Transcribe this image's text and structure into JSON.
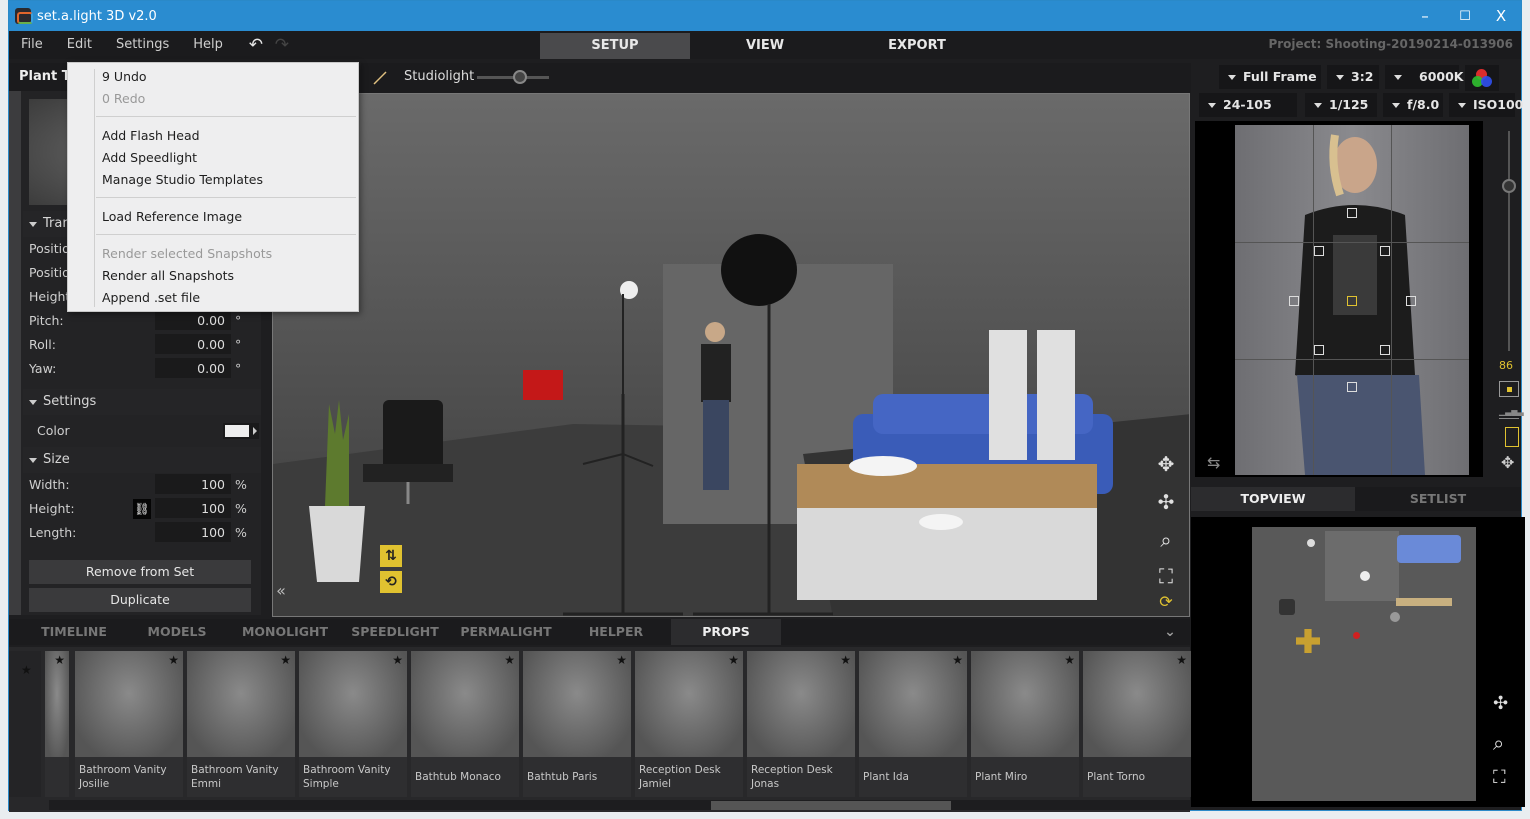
{
  "window": {
    "title": "set.a.light 3D v2.0",
    "controls": {
      "minimize": "–",
      "maximize": "☐",
      "close": "X"
    }
  },
  "menu": {
    "items": [
      "File",
      "Edit",
      "Settings",
      "Help"
    ],
    "undo_icon": "undo-icon",
    "redo_icon": "redo-icon"
  },
  "modes": {
    "tabs": [
      "SETUP",
      "VIEW",
      "EXPORT"
    ],
    "active": "SETUP"
  },
  "project": "Project: Shooting-20190214-013906",
  "edit_menu": {
    "groups": [
      [
        {
          "label": "9 Undo",
          "enabled": true
        },
        {
          "label": "0 Redo",
          "enabled": false
        }
      ],
      [
        {
          "label": "Add Flash Head",
          "enabled": true
        },
        {
          "label": "Add Speedlight",
          "enabled": true
        },
        {
          "label": "Manage Studio Templates",
          "enabled": true
        }
      ],
      [
        {
          "label": "Load Reference Image",
          "enabled": true
        }
      ],
      [
        {
          "label": "Render selected Snapshots",
          "enabled": false
        },
        {
          "label": "Render all Snapshots",
          "enabled": true
        },
        {
          "label": "Append .set file",
          "enabled": true
        }
      ]
    ]
  },
  "left_panel": {
    "title": "Plant Torno",
    "transform": {
      "header": "Transform",
      "fields": [
        {
          "label": "Position X:",
          "value": ""
        },
        {
          "label": "Position Y:",
          "value": ""
        },
        {
          "label": "Height:",
          "value": ""
        },
        {
          "label": "Pitch:",
          "value": "0.00",
          "unit": "°"
        },
        {
          "label": "Roll:",
          "value": "0.00",
          "unit": "°"
        },
        {
          "label": "Yaw:",
          "value": "0.00",
          "unit": "°"
        }
      ]
    },
    "settings": {
      "header": "Settings",
      "color_label": "Color",
      "color_value": "#eeeeee"
    },
    "size": {
      "header": "Size",
      "fields": [
        {
          "label": "Width:",
          "value": "100",
          "unit": "%"
        },
        {
          "label": "Height:",
          "value": "100",
          "unit": "%"
        },
        {
          "label": "Length:",
          "value": "100",
          "unit": "%"
        }
      ]
    },
    "buttons": {
      "remove": "Remove from Set",
      "duplicate": "Duplicate"
    }
  },
  "viewport": {
    "ambient_label": "Studiolight",
    "ambient_level": 0.6
  },
  "bottom_tabs": {
    "items": [
      "TIMELINE",
      "MODELS",
      "MONOLIGHT",
      "SPEEDLIGHT",
      "PERMALIGHT",
      "HELPER",
      "PROPS"
    ],
    "active": "PROPS"
  },
  "props": [
    {
      "name": "Bathroom Vanity Josilie"
    },
    {
      "name": "Bathroom Vanity Emmi"
    },
    {
      "name": "Bathroom Vanity Simple"
    },
    {
      "name": "Bathtub Monaco"
    },
    {
      "name": "Bathtub Paris"
    },
    {
      "name": "Reception Desk Jamiel"
    },
    {
      "name": "Reception Desk Jonas"
    },
    {
      "name": "Plant Ida"
    },
    {
      "name": "Plant Miro"
    },
    {
      "name": "Plant Torno"
    }
  ],
  "camera": {
    "sensor": "Full Frame",
    "aspect": "3:2",
    "white_balance": "6000K",
    "lens": "24-105 mm",
    "shutter": "1/125 s",
    "aperture": "f/8.0",
    "iso": "ISO100",
    "zoom_value": "86"
  },
  "right_tabs": {
    "items": [
      "TOPVIEW",
      "SETLIST"
    ],
    "active": "TOPVIEW"
  },
  "colors": {
    "accent": "#2a8cd0",
    "highlight": "#e0c230",
    "panel": "#1e1e20"
  }
}
